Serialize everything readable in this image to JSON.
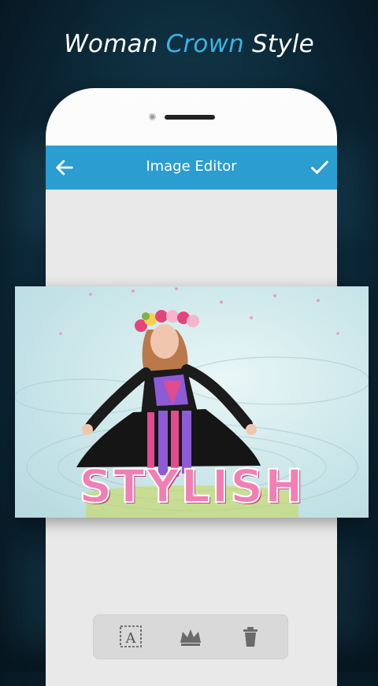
{
  "promo": {
    "headline_prefix": "Woman",
    "headline_accent": "Crown",
    "headline_suffix": "Style"
  },
  "appbar": {
    "title": "Image Editor",
    "back_icon": "arrow-left-icon",
    "confirm_icon": "checkmark-icon"
  },
  "photo": {
    "overlay_text": "STYLISH"
  },
  "toolbar": {
    "items": [
      {
        "icon": "text-tool-icon"
      },
      {
        "icon": "crown-icon"
      },
      {
        "icon": "trash-icon"
      }
    ]
  },
  "colors": {
    "accent": "#3ab3e6",
    "appbar": "#2b9dd0",
    "overlay_text": "#f27fb4"
  }
}
